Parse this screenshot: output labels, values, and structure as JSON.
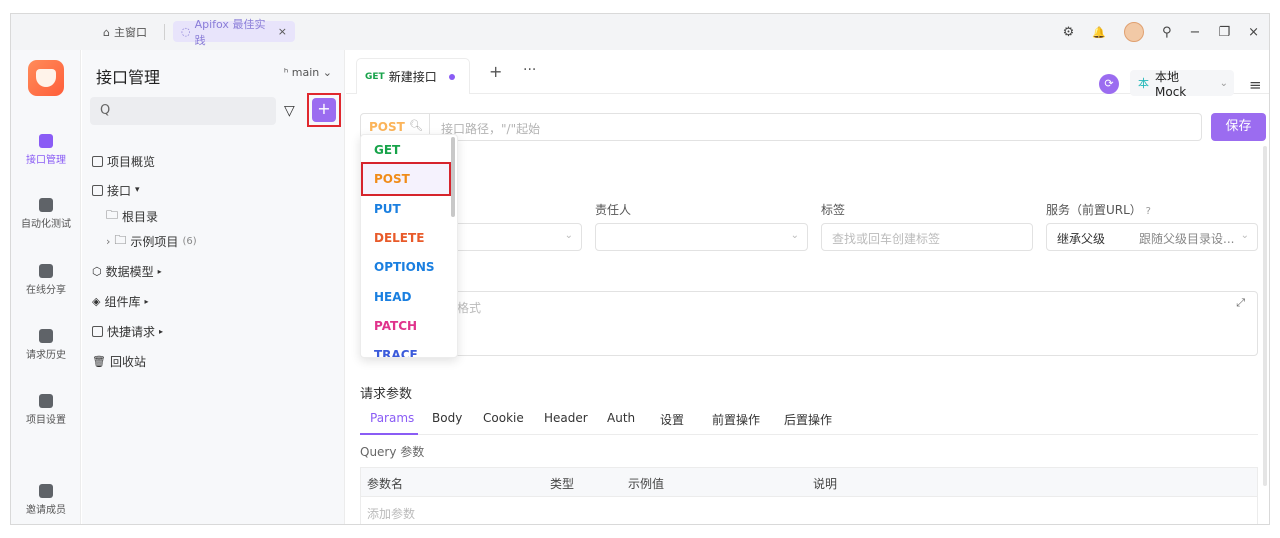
{
  "titlebar": {
    "home_label": "主窗口",
    "tab_label": "Apifox 最佳实践",
    "tab_close": "×",
    "controls": {
      "settings": "⚙",
      "bell": "🔔",
      "pin": "⚲",
      "minimize": "−",
      "maximize": "❐",
      "close": "×"
    }
  },
  "rail": {
    "items": [
      {
        "label": "接口管理",
        "icon": "api-icon",
        "active": true
      },
      {
        "label": "自动化测试",
        "icon": "automation-icon",
        "active": false
      },
      {
        "label": "在线分享",
        "icon": "share-icon",
        "active": false
      },
      {
        "label": "请求历史",
        "icon": "history-icon",
        "active": false
      },
      {
        "label": "项目设置",
        "icon": "settings-icon",
        "active": false
      },
      {
        "label": "邀请成员",
        "icon": "invite-icon",
        "active": false
      }
    ]
  },
  "tree": {
    "title": "接口管理",
    "branch": "main",
    "search_icon": "Q",
    "filter_icon": "▽",
    "add_icon": "+",
    "rows": [
      {
        "label": "项目概览"
      },
      {
        "label": "接口",
        "caret": "▾"
      },
      {
        "label": "根目录"
      },
      {
        "label": "示例项目",
        "count": "(6)",
        "caret": "›"
      },
      {
        "label": "数据模型",
        "caret": "▸"
      },
      {
        "label": "组件库",
        "caret": "▸"
      },
      {
        "label": "快捷请求",
        "caret": "▸"
      },
      {
        "label": "回收站"
      }
    ]
  },
  "main": {
    "tab": {
      "method": "GET",
      "label": "新建接口"
    },
    "tab_plus": "+",
    "tab_more": "···",
    "environment": {
      "tag": "本",
      "label": "本地 Mock"
    },
    "menu_icon": "≡",
    "url": {
      "method": "POST",
      "placeholder": "接口路径，\"/\"起始"
    },
    "save_label": "保存",
    "fields": {
      "owner_label": "责任人",
      "tags_label": "标签",
      "tags_placeholder": "查找或回车创建标签",
      "service_label": "服务（前置URL）",
      "service_help": "?",
      "service_value": "继承父级",
      "service_hint": "跟随父级目录设..."
    },
    "description_placeholder": "格式",
    "params_title": "请求参数",
    "param_tabs": [
      "Params",
      "Body",
      "Cookie",
      "Header",
      "Auth",
      "设置",
      "前置操作",
      "后置操作"
    ],
    "query_label": "Query 参数",
    "table": {
      "columns": [
        "参数名",
        "类型",
        "示例值",
        "说明"
      ],
      "add_row": "添加参数"
    }
  },
  "method_menu": {
    "items": [
      {
        "label": "GET",
        "color": "#17a34a"
      },
      {
        "label": "POST",
        "color": "#f08c19"
      },
      {
        "label": "PUT",
        "color": "#1a7fe0"
      },
      {
        "label": "DELETE",
        "color": "#e85a2a"
      },
      {
        "label": "OPTIONS",
        "color": "#1a7fe0"
      },
      {
        "label": "HEAD",
        "color": "#1a7fe0"
      },
      {
        "label": "PATCH",
        "color": "#e0338c"
      },
      {
        "label": "TRACE",
        "color": "#3b5bdb"
      }
    ],
    "selected": "POST"
  },
  "colors": {
    "accent": "#9b6cf0",
    "highlight_border": "#e0282e"
  }
}
